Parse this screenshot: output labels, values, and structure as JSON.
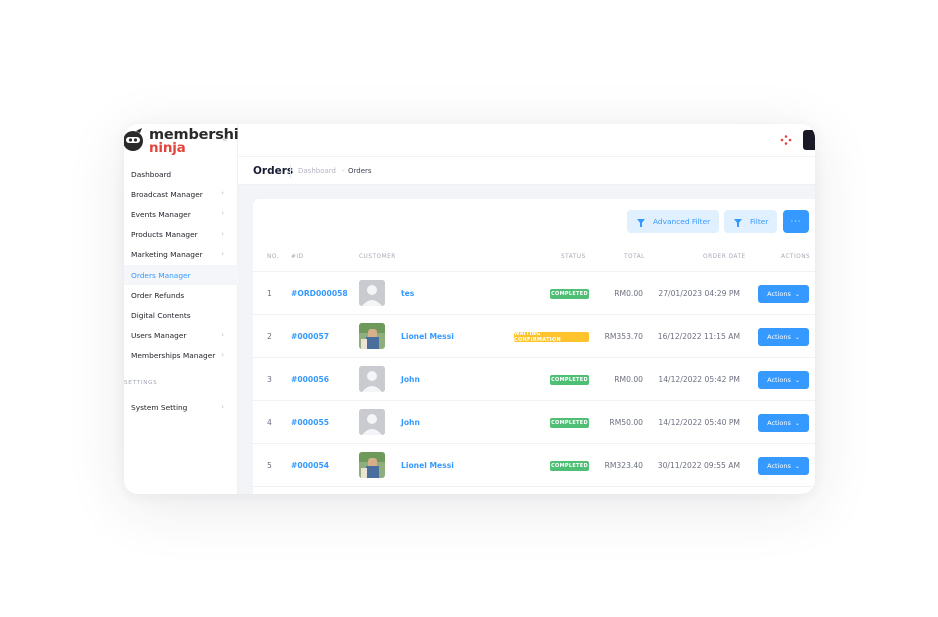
{
  "brand": {
    "line1": "membership",
    "line2": "ninja",
    "collapse": "«"
  },
  "sidebar": {
    "items": [
      {
        "label": "Dashboard",
        "chevron": ""
      },
      {
        "label": "Broadcast Manager",
        "chevron": "›"
      },
      {
        "label": "Events Manager",
        "chevron": "›"
      },
      {
        "label": "Products Manager",
        "chevron": "›"
      },
      {
        "label": "Marketing Manager",
        "chevron": "›"
      },
      {
        "label": "Orders Manager",
        "chevron": "",
        "active": true
      },
      {
        "label": "Order Refunds",
        "chevron": ""
      },
      {
        "label": "Digital Contents",
        "chevron": ""
      },
      {
        "label": "Users Manager",
        "chevron": "›"
      },
      {
        "label": "Memberships Manager",
        "chevron": "›"
      }
    ],
    "section_label": "SETTINGS",
    "settings_items": [
      {
        "label": "System Setting",
        "chevron": "›"
      }
    ]
  },
  "header": {
    "title": "Orders",
    "breadcrumb": [
      "Dashboard",
      "Orders"
    ],
    "breadcrumb_sep": "-"
  },
  "toolbar": {
    "advanced_filter": "Advanced Filter",
    "filter": "Filter",
    "more": "···"
  },
  "table": {
    "columns": {
      "no": "NO.",
      "id": "#ID",
      "customer": "CUSTOMER",
      "status": "STATUS",
      "total": "TOTAL",
      "order_date": "ORDER DATE",
      "actions": "ACTIONS"
    },
    "action_label": "Actions",
    "action_chevron": "⌄",
    "rows": [
      {
        "no": "1",
        "id": "#ORD000058",
        "customer": "tes",
        "avatar": "placeholder",
        "status": "COMPLETED",
        "total": "RM0.00",
        "date": "27/01/2023 04:29 PM"
      },
      {
        "no": "2",
        "id": "#000057",
        "customer": "Lionel Messi",
        "avatar": "photo",
        "status": "WAITING CONFIRMATION",
        "total": "RM353.70",
        "date": "16/12/2022 11:15 AM"
      },
      {
        "no": "3",
        "id": "#000056",
        "customer": "John",
        "avatar": "placeholder",
        "status": "COMPLETED",
        "total": "RM0.00",
        "date": "14/12/2022 05:42 PM"
      },
      {
        "no": "4",
        "id": "#000055",
        "customer": "John",
        "avatar": "placeholder",
        "status": "COMPLETED",
        "total": "RM50.00",
        "date": "14/12/2022 05:40 PM"
      },
      {
        "no": "5",
        "id": "#000054",
        "customer": "Lionel Messi",
        "avatar": "photo",
        "status": "COMPLETED",
        "total": "RM323.40",
        "date": "30/11/2022 09:55 AM"
      }
    ]
  },
  "colors": {
    "accent": "#3699ff",
    "completed": "#4fbf75",
    "waiting": "#ffc42d",
    "brand_red": "#e2453b"
  }
}
